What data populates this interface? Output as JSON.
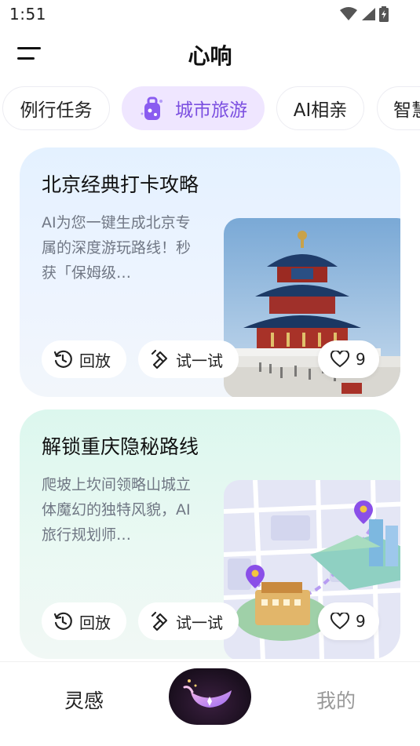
{
  "status": {
    "time": "1:51"
  },
  "header": {
    "title": "心响"
  },
  "tabs": [
    {
      "label": "例行任务",
      "active": false
    },
    {
      "label": "城市旅游",
      "active": true
    },
    {
      "label": "AI相亲",
      "active": false
    },
    {
      "label": "智慧",
      "active": false
    }
  ],
  "cards": [
    {
      "title": "北京经典打卡攻略",
      "description": "AI为您一键生成北京专属的深度游玩路线！秒获「保姆级…",
      "replay_label": "回放",
      "try_label": "试一试",
      "likes": "9"
    },
    {
      "title": "解锁重庆隐秘路线",
      "description": "爬坡上坎间领略山城立体魔幻的独特风貌，AI旅行规划师…",
      "replay_label": "回放",
      "try_label": "试一试",
      "likes": "9"
    }
  ],
  "bottom_nav": {
    "left_label": "灵感",
    "right_label": "我的"
  },
  "colors": {
    "accent": "#7b4fe0",
    "tab_active_bg": "#efe6ff"
  }
}
